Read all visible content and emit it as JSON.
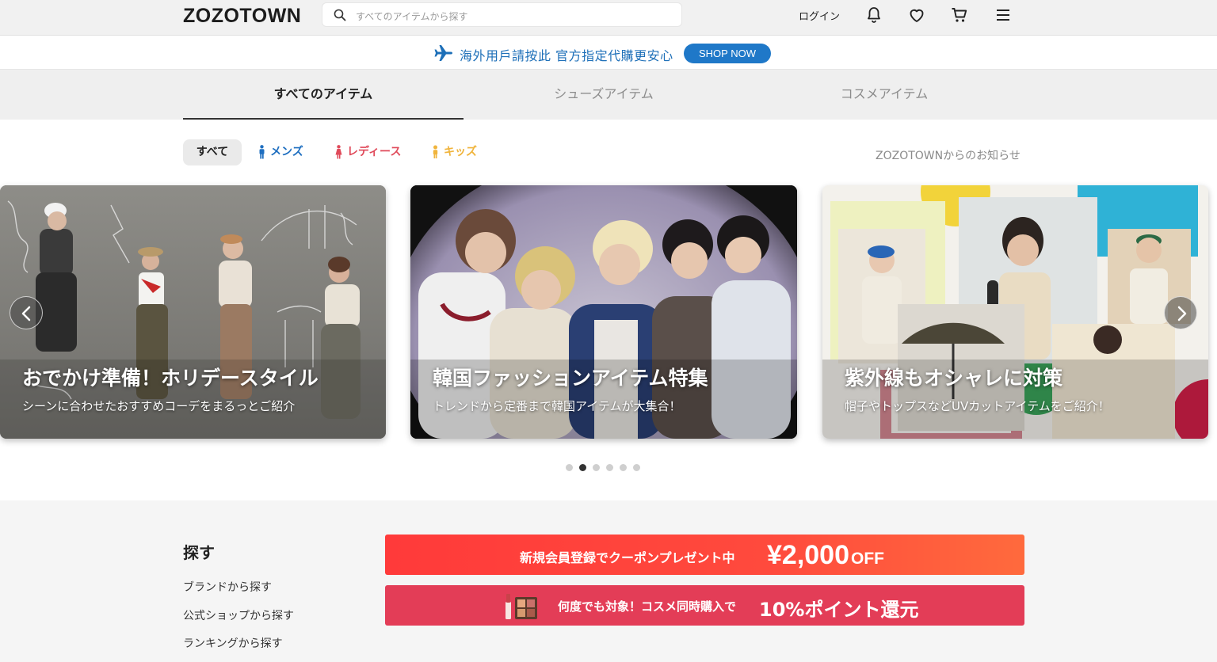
{
  "header": {
    "logo": "ZOZOTOWN",
    "search_placeholder": "すべてのアイテムから探す",
    "login": "ログイン",
    "icons": [
      "bell-icon",
      "heart-icon",
      "cart-icon",
      "menu-icon"
    ]
  },
  "promo": {
    "text": "海外用戶請按此 官方指定代購更安心",
    "button": "SHOP NOW",
    "color": "#1d6fb8"
  },
  "tabs": [
    {
      "label": "すべてのアイテム",
      "active": true
    },
    {
      "label": "シューズアイテム",
      "active": false
    },
    {
      "label": "コスメアイテム",
      "active": false
    }
  ],
  "filters": [
    {
      "label": "すべて",
      "color": "#222222"
    },
    {
      "label": "メンズ",
      "color": "#1f6fc0"
    },
    {
      "label": "レディース",
      "color": "#e04a5a"
    },
    {
      "label": "キッズ",
      "color": "#f0b43c"
    }
  ],
  "notice": "ZOZOTOWNからのお知らせ",
  "slides": [
    {
      "title": "おでかけ準備！ホリデースタイル",
      "subtitle": "シーンに合わせたおすすめコーデをまるっとご紹介"
    },
    {
      "title": "韓国ファッションアイテム特集",
      "subtitle": "トレンドから定番まで韓国アイテムが大集合！"
    },
    {
      "title": "紫外線もオシャレに対策",
      "subtitle": "帽子やトップスなどUVカットアイテムをご紹介！"
    }
  ],
  "carousel": {
    "total_dots": 6,
    "active_index": 1
  },
  "find": {
    "title": "探す",
    "links": [
      "ブランドから探す",
      "公式ショップから探す",
      "ランキングから探す"
    ]
  },
  "banners": {
    "coupon": {
      "text": "新規会員登録でクーポンプレゼント中",
      "amount": "¥2,000",
      "suffix": "OFF"
    },
    "cosme": {
      "text": "何度でも対象！コスメ同時購入で",
      "highlight": "10%ポイント還元"
    }
  }
}
